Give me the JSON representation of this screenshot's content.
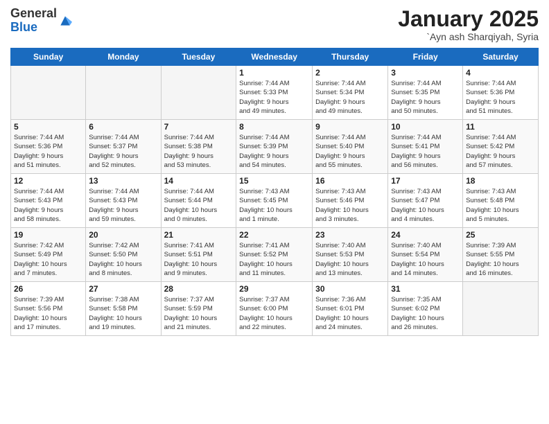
{
  "logo": {
    "general": "General",
    "blue": "Blue"
  },
  "header": {
    "month": "January 2025",
    "location": "`Ayn ash Sharqiyah, Syria"
  },
  "days_header": [
    "Sunday",
    "Monday",
    "Tuesday",
    "Wednesday",
    "Thursday",
    "Friday",
    "Saturday"
  ],
  "weeks": [
    [
      {
        "day": "",
        "info": ""
      },
      {
        "day": "",
        "info": ""
      },
      {
        "day": "",
        "info": ""
      },
      {
        "day": "1",
        "info": "Sunrise: 7:44 AM\nSunset: 5:33 PM\nDaylight: 9 hours\nand 49 minutes."
      },
      {
        "day": "2",
        "info": "Sunrise: 7:44 AM\nSunset: 5:34 PM\nDaylight: 9 hours\nand 49 minutes."
      },
      {
        "day": "3",
        "info": "Sunrise: 7:44 AM\nSunset: 5:35 PM\nDaylight: 9 hours\nand 50 minutes."
      },
      {
        "day": "4",
        "info": "Sunrise: 7:44 AM\nSunset: 5:36 PM\nDaylight: 9 hours\nand 51 minutes."
      }
    ],
    [
      {
        "day": "5",
        "info": "Sunrise: 7:44 AM\nSunset: 5:36 PM\nDaylight: 9 hours\nand 51 minutes."
      },
      {
        "day": "6",
        "info": "Sunrise: 7:44 AM\nSunset: 5:37 PM\nDaylight: 9 hours\nand 52 minutes."
      },
      {
        "day": "7",
        "info": "Sunrise: 7:44 AM\nSunset: 5:38 PM\nDaylight: 9 hours\nand 53 minutes."
      },
      {
        "day": "8",
        "info": "Sunrise: 7:44 AM\nSunset: 5:39 PM\nDaylight: 9 hours\nand 54 minutes."
      },
      {
        "day": "9",
        "info": "Sunrise: 7:44 AM\nSunset: 5:40 PM\nDaylight: 9 hours\nand 55 minutes."
      },
      {
        "day": "10",
        "info": "Sunrise: 7:44 AM\nSunset: 5:41 PM\nDaylight: 9 hours\nand 56 minutes."
      },
      {
        "day": "11",
        "info": "Sunrise: 7:44 AM\nSunset: 5:42 PM\nDaylight: 9 hours\nand 57 minutes."
      }
    ],
    [
      {
        "day": "12",
        "info": "Sunrise: 7:44 AM\nSunset: 5:43 PM\nDaylight: 9 hours\nand 58 minutes."
      },
      {
        "day": "13",
        "info": "Sunrise: 7:44 AM\nSunset: 5:43 PM\nDaylight: 9 hours\nand 59 minutes."
      },
      {
        "day": "14",
        "info": "Sunrise: 7:44 AM\nSunset: 5:44 PM\nDaylight: 10 hours\nand 0 minutes."
      },
      {
        "day": "15",
        "info": "Sunrise: 7:43 AM\nSunset: 5:45 PM\nDaylight: 10 hours\nand 1 minute."
      },
      {
        "day": "16",
        "info": "Sunrise: 7:43 AM\nSunset: 5:46 PM\nDaylight: 10 hours\nand 3 minutes."
      },
      {
        "day": "17",
        "info": "Sunrise: 7:43 AM\nSunset: 5:47 PM\nDaylight: 10 hours\nand 4 minutes."
      },
      {
        "day": "18",
        "info": "Sunrise: 7:43 AM\nSunset: 5:48 PM\nDaylight: 10 hours\nand 5 minutes."
      }
    ],
    [
      {
        "day": "19",
        "info": "Sunrise: 7:42 AM\nSunset: 5:49 PM\nDaylight: 10 hours\nand 7 minutes."
      },
      {
        "day": "20",
        "info": "Sunrise: 7:42 AM\nSunset: 5:50 PM\nDaylight: 10 hours\nand 8 minutes."
      },
      {
        "day": "21",
        "info": "Sunrise: 7:41 AM\nSunset: 5:51 PM\nDaylight: 10 hours\nand 9 minutes."
      },
      {
        "day": "22",
        "info": "Sunrise: 7:41 AM\nSunset: 5:52 PM\nDaylight: 10 hours\nand 11 minutes."
      },
      {
        "day": "23",
        "info": "Sunrise: 7:40 AM\nSunset: 5:53 PM\nDaylight: 10 hours\nand 13 minutes."
      },
      {
        "day": "24",
        "info": "Sunrise: 7:40 AM\nSunset: 5:54 PM\nDaylight: 10 hours\nand 14 minutes."
      },
      {
        "day": "25",
        "info": "Sunrise: 7:39 AM\nSunset: 5:55 PM\nDaylight: 10 hours\nand 16 minutes."
      }
    ],
    [
      {
        "day": "26",
        "info": "Sunrise: 7:39 AM\nSunset: 5:56 PM\nDaylight: 10 hours\nand 17 minutes."
      },
      {
        "day": "27",
        "info": "Sunrise: 7:38 AM\nSunset: 5:58 PM\nDaylight: 10 hours\nand 19 minutes."
      },
      {
        "day": "28",
        "info": "Sunrise: 7:37 AM\nSunset: 5:59 PM\nDaylight: 10 hours\nand 21 minutes."
      },
      {
        "day": "29",
        "info": "Sunrise: 7:37 AM\nSunset: 6:00 PM\nDaylight: 10 hours\nand 22 minutes."
      },
      {
        "day": "30",
        "info": "Sunrise: 7:36 AM\nSunset: 6:01 PM\nDaylight: 10 hours\nand 24 minutes."
      },
      {
        "day": "31",
        "info": "Sunrise: 7:35 AM\nSunset: 6:02 PM\nDaylight: 10 hours\nand 26 minutes."
      },
      {
        "day": "",
        "info": ""
      }
    ]
  ]
}
